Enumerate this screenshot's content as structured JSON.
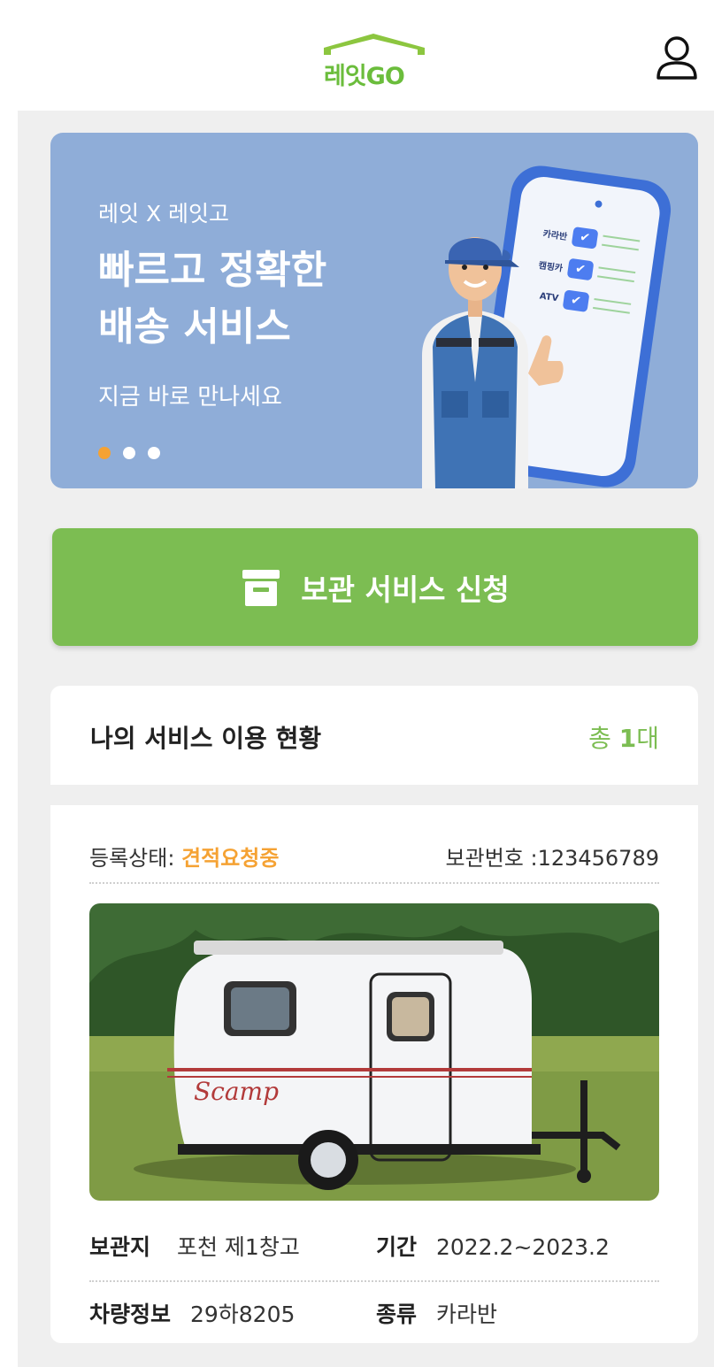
{
  "header": {
    "logo_text": "레잇GO",
    "icons": {
      "profile": "user-icon"
    }
  },
  "banner": {
    "kicker": "레잇 X 레잇고",
    "title": "빠르고 정확한\n배송 서비스",
    "subtitle": "지금 바로 만나세요",
    "slide_count": 3,
    "active_slide": 1,
    "phone_items": [
      "카라반",
      "캠핑카",
      "ATV"
    ]
  },
  "cta": {
    "label": "보관 서비스 신청",
    "icon": "archive-box-icon"
  },
  "status": {
    "title": "나의 서비스 이용 현황",
    "count_prefix": "총 ",
    "count_value": "1",
    "count_suffix": "대"
  },
  "card": {
    "reg_label": "등록상태: ",
    "reg_value": "견적요청중",
    "storage_no": "보관번호 :123456789",
    "photo_text": "Scamp",
    "location_key": "보관지",
    "location_val": "포천 제1창고",
    "period_key": "기간",
    "period_val": "2022.2~2023.2",
    "vehicle_key": "차량정보",
    "vehicle_val": "29하8205",
    "type_key": "종류",
    "type_val": "카라반"
  },
  "colors": {
    "brand_green": "#7cbd52",
    "accent_orange": "#f5a233",
    "banner_bg": "#8fadd8"
  }
}
